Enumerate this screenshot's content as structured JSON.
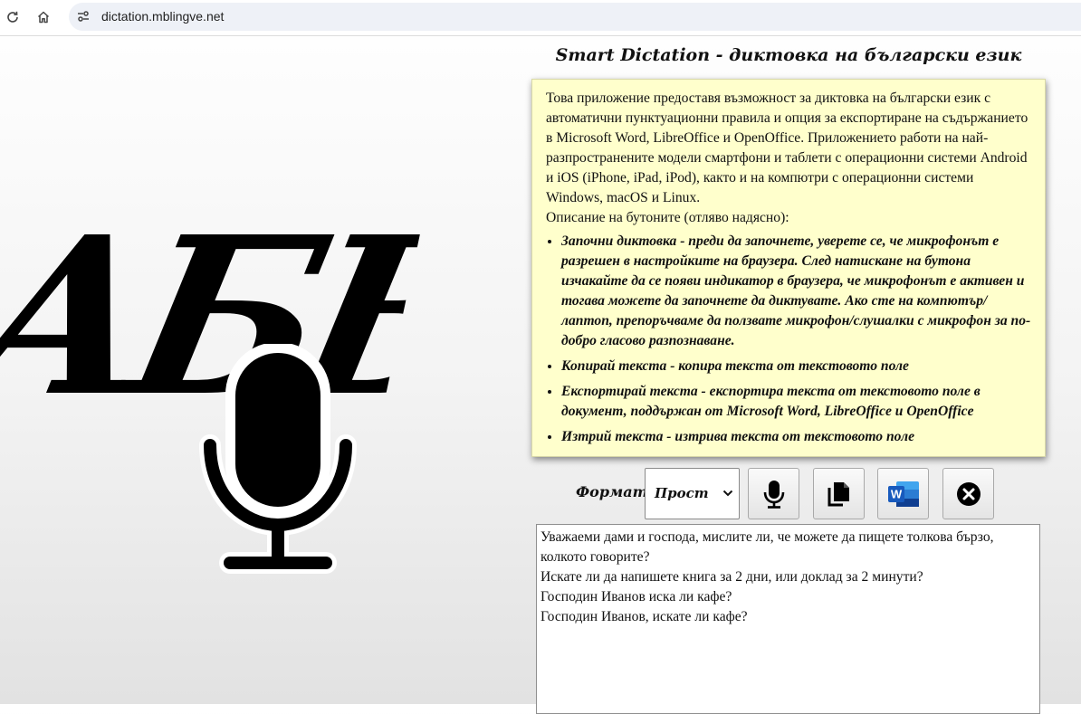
{
  "browser": {
    "url": "dictation.mblingve.net"
  },
  "logo": {
    "letters": "АБВ"
  },
  "app": {
    "title": "Smart Dictation - диктовка на български език"
  },
  "info": {
    "intro": "Това приложение предоставя възможност за диктовка на български език с автоматични пунктуационни правила и опция за експортиране на съдържанието в Microsoft Word, LibreOffice и OpenOffice. Приложението работи на най-разпространените модели смартфони и таблети с операционни системи Android и iOS (iPhone, iPad, iPod), както и на компютри с операционни системи Windows, macOS и Linux.",
    "buttons_caption": "Описание на бутоните (отляво надясно):",
    "items": [
      "Започни диктовка - преди да започнете, уверете се, че микрофонът е разрешен в настройките на браузера. След натискане на бутона изчакайте да се появи индикатор в браузера, че микрофонът е активен и тогава можете да започнете да диктувате. Ако сте на компютър/лаптоп, препоръчваме да ползвате микрофон/слушалки с микрофон за по-добро гласово разпознаване.",
      "Копирай текста - копира текста от текстовото поле",
      "Експортирай текста - експортира текста от текстовото поле в документ, поддържан от Microsoft Word, LibreOffice и OpenOffice",
      "Изтрий текста - изтрива текста от текстовото поле"
    ]
  },
  "controls": {
    "format_label": "Формат:",
    "format_selected": "Прост",
    "dictate_icon": "microphone-icon",
    "copy_icon": "copy-icon",
    "export_icon": "word-icon",
    "delete_icon": "close-circle-icon"
  },
  "textarea": {
    "lines": [
      "Уважаеми дами и господа, мислите ли, че можете да пищете толкова бързо,",
      "колкото говорите?",
      "Искате ли да напишете книга за 2 дни, или доклад за 2 минути?",
      "Господин Иванов иска ли кафе?",
      "Господин Иванов, искате ли кафе?"
    ]
  },
  "colors": {
    "info_background": "#ffffcc",
    "word_blue": "#185abd"
  }
}
